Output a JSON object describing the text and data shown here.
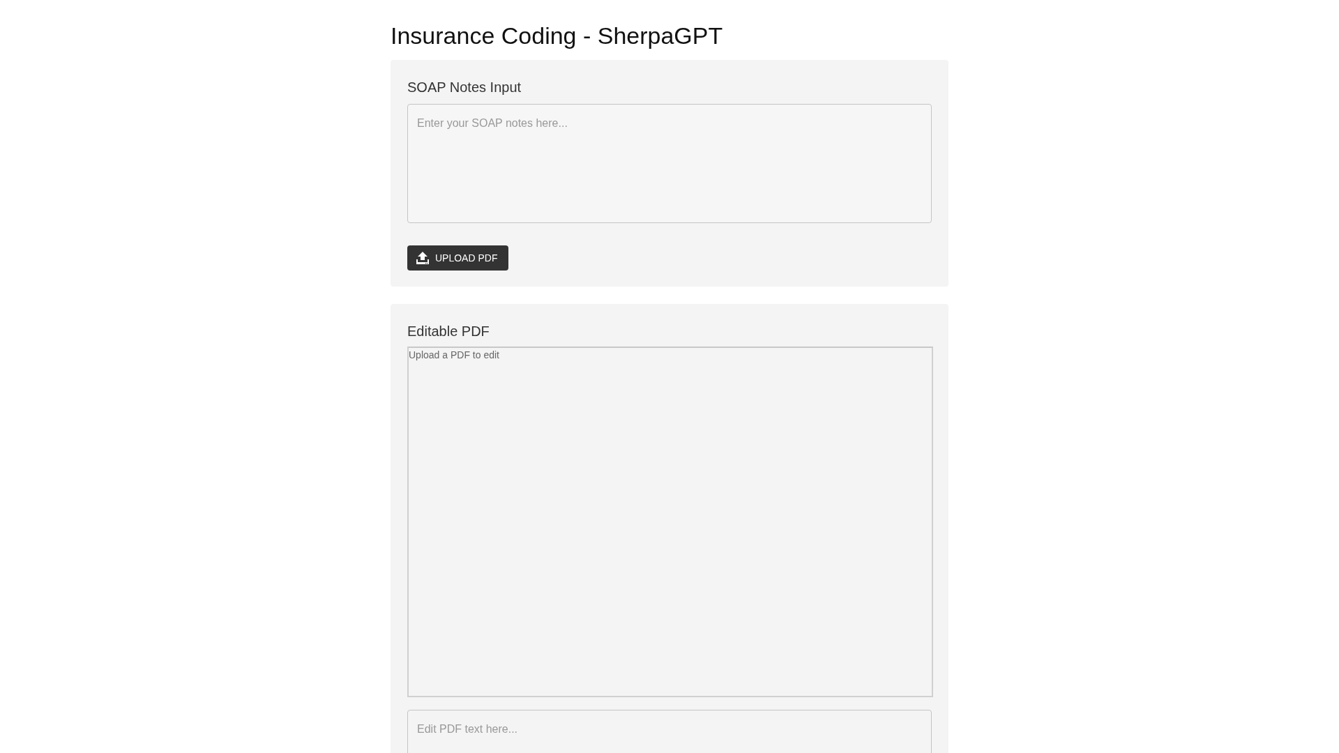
{
  "page": {
    "title": "Insurance Coding - SherpaGPT"
  },
  "soap_section": {
    "heading": "SOAP Notes Input",
    "notes_field": {
      "placeholder": "Enter your SOAP notes here..."
    },
    "upload_button": {
      "label": "UPLOAD PDF"
    }
  },
  "pdf_section": {
    "heading": "Editable PDF",
    "viewer": {
      "message": "Upload a PDF to edit"
    },
    "edit_field": {
      "placeholder": "Edit PDF text here..."
    }
  }
}
